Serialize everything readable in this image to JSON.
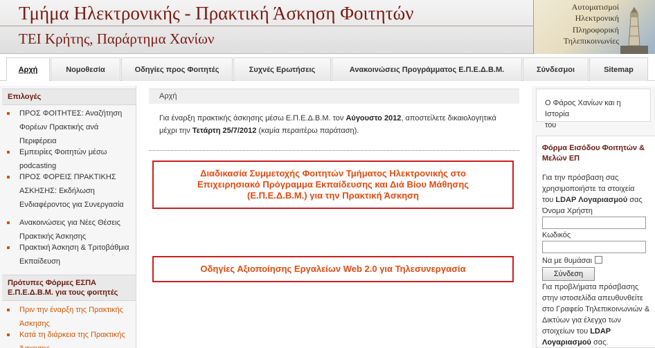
{
  "header": {
    "title": "Τμήμα Ηλεκτρονικής - Πρακτική Άσκηση Φοιτητών",
    "subtitle": "ΤΕΙ Κρήτης, Παράρτημα Χανίων",
    "banner_lines": [
      "Αυτοματισμοί",
      "Ηλεκτρονική",
      "Πληροφορική",
      "Τηλεπικοινωνίες"
    ],
    "colors": {
      "title": "#7b1b12",
      "accent": "#d45500",
      "promo_border": "#cc1d1d"
    }
  },
  "nav": {
    "tabs": [
      {
        "label": "Αρχή",
        "active": true
      },
      {
        "label": "Νομοθεσία",
        "active": false
      },
      {
        "label": "Οδηγίες προς Φοιτητές",
        "active": false
      },
      {
        "label": "Συχνές Ερωτήσεις",
        "active": false
      },
      {
        "label": "Ανακοινώσεις Προγράμματος Ε.Π.Ε.Δ.Β.Μ.",
        "active": false
      },
      {
        "label": "Σύνδεσμοι",
        "active": false
      },
      {
        "label": "Sitemap",
        "active": false
      }
    ]
  },
  "left": {
    "sections": [
      {
        "heading": "Επιλογές",
        "items": [
          {
            "lines": [
              "ΠΡΟΣ ΦΟΙΤΗΤΕΣ: Αναζήτηση",
              "Φορέων Πρακτικής ανά",
              "Περιφέρεια"
            ]
          },
          {
            "lines": [
              "Εμπειρίες Φοιτητών μέσω",
              "podcasting"
            ]
          },
          {
            "lines": [
              "ΠΡΟΣ ΦΟΡΕΙΣ ΠΡΑΚΤΙΚΗΣ",
              "ΑΣΚΗΣΗΣ: Εκδήλωση",
              "Ενδιαφέροντος για Συνεργασία"
            ]
          },
          {
            "lines": [
              "Ανακοινώσεις για Νέες Θέσεις",
              "Πρακτικής Άσκησης"
            ]
          },
          {
            "lines": [
              "Πρακτική Άσκηση & Τριτοβάθμια",
              "Εκπαίδευση"
            ]
          }
        ]
      },
      {
        "heading_lines": [
          "Πρότυπες Φόρμες ΕΣΠΑ",
          "Ε.Π.Ε.Δ.Β.Μ. για τους φοιτητές"
        ],
        "items": [
          {
            "lines": [
              "Πριν την έναρξη της Πρακτικής",
              "Άσκησης"
            ]
          },
          {
            "lines": [
              "Κατά τη διάρκεια της Πρακτικής",
              "Άσκησης"
            ]
          }
        ]
      }
    ]
  },
  "main": {
    "breadcrumb": "Αρχή",
    "intro": {
      "p1": "Για έναρξη πρακτικής άσκησης μέσω Ε.Π.Ε.Δ.Β.Μ. τον ",
      "b1": "Αύγουστο 2012",
      "p2": ", αποστείλετε δικαιολογητικά μέχρι την ",
      "b2": "Τετάρτη 25/7/2012",
      "p3": " (καμία περαιτέρω παράταση)."
    },
    "promo1_lines": [
      "Διαδικασία Συμμετοχής Φοιτητών Τμήματος Ηλεκτρονικής στο",
      "Επιχειρησιακό Πρόγραμμα Εκπαίδευσης και Διά Βίου Μάθησης",
      "(Ε.Π.Ε.Δ.Β.Μ.) για την Πρακτική Άσκηση"
    ],
    "promo2": "Οδηγίες Αξιοποίησης Εργαλείων Web 2.0 για Τηλεσυνεργασία"
  },
  "right": {
    "link_lines": [
      "Ο Φάρος Χανίων και η Ιστορία",
      "του"
    ],
    "login": {
      "title_lines": [
        "Φόρμα Εισόδου Φοιτητών &",
        "Μελών ΕΠ"
      ],
      "help_lines": [
        "Για την πρόσβαση σας",
        "χρησιμοποιήστε τα στοιχεία",
        "του "
      ],
      "help_bold": "LDAP Λογαριασμού",
      "help_tail": " σας",
      "username_label": "Όνομα Χρήστη",
      "password_label": "Κωδικός",
      "remember_label": "Να με θυμάσαι",
      "submit": "Σύνδεση",
      "problem_lines": [
        "Για προβλήματα πρόσβασης",
        "στην ιστοσελίδα απευθυνθείτε",
        "στο Γραφείο Τηλεπικοινωνιών &",
        "Δικτύων για έλεγχο των",
        "στοιχείων του "
      ],
      "problem_bold": "LDAP",
      "problem_bold2": "Λογαριασμού",
      "problem_tail": " σας."
    }
  }
}
